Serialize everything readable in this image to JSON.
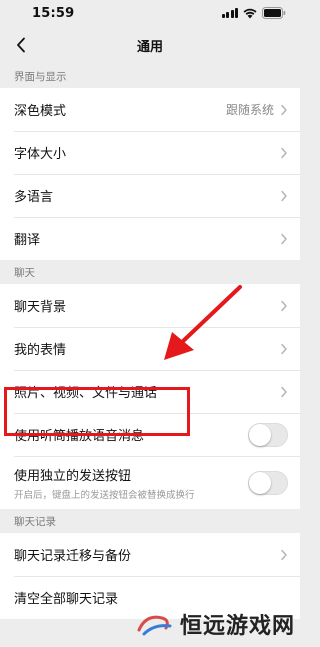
{
  "status_bar": {
    "time": "15:59",
    "icons": [
      "signal-icon",
      "wifi-icon",
      "battery-icon"
    ]
  },
  "nav": {
    "title": "通用",
    "back_icon": "chevron-left-icon"
  },
  "sections": [
    {
      "header": "界面与显示",
      "rows": [
        {
          "label": "深色模式",
          "value": "跟随系统"
        },
        {
          "label": "字体大小"
        },
        {
          "label": "多语言"
        },
        {
          "label": "翻译"
        }
      ]
    },
    {
      "header": "聊天",
      "rows": [
        {
          "label": "聊天背景"
        },
        {
          "label": "我的表情"
        },
        {
          "label": "照片、视频、文件与通话"
        },
        {
          "label": "使用听筒播放语音消息",
          "toggle": false
        },
        {
          "label": "使用独立的发送按钮",
          "sublabel": "开启后，键盘上的发送按钮会被替换成换行",
          "toggle": false
        }
      ]
    },
    {
      "header": "聊天记录",
      "rows": [
        {
          "label": "聊天记录迁移与备份"
        },
        {
          "label": "清空全部聊天记录"
        }
      ]
    }
  ],
  "overlay": {
    "highlight_color": "#e5191b",
    "arrow_color": "#e5191b",
    "watermark": "恒远游戏网"
  }
}
